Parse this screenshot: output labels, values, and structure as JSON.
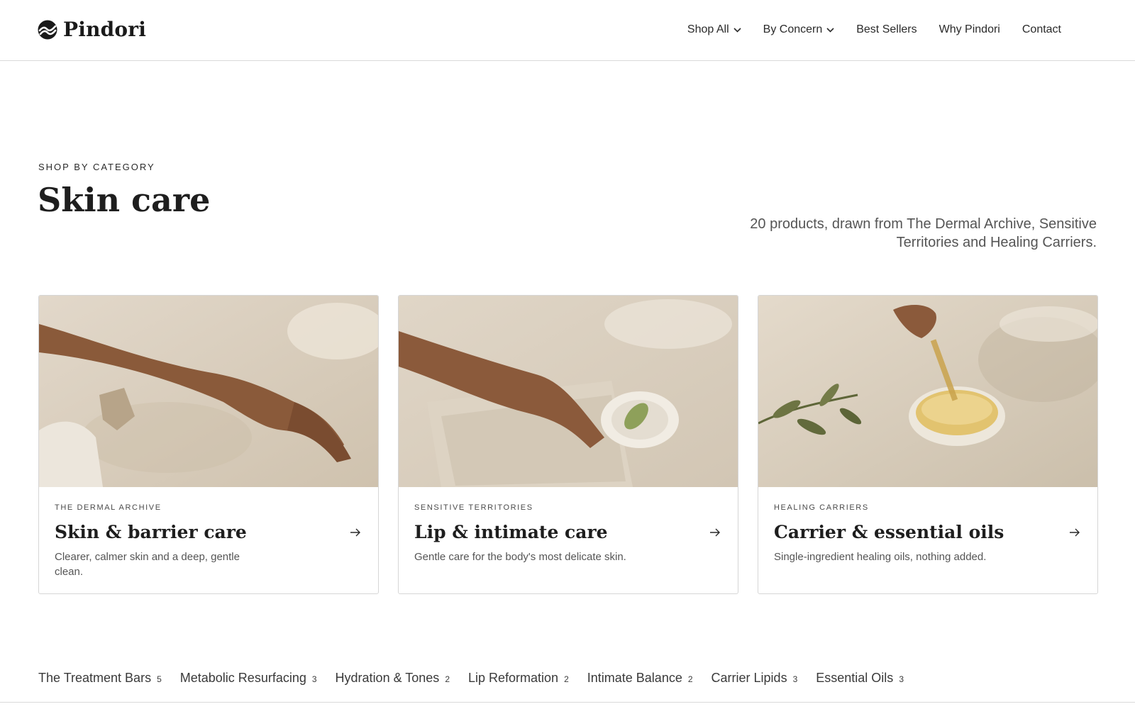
{
  "brand": {
    "name": "Pindori",
    "logo_icon": "pindori-logo-icon"
  },
  "nav": {
    "items": [
      {
        "label": "Shop All",
        "dropdown": true
      },
      {
        "label": "By Concern",
        "dropdown": true
      },
      {
        "label": "Best Sellers",
        "dropdown": false
      },
      {
        "label": "Why Pindori",
        "dropdown": false
      },
      {
        "label": "Contact",
        "dropdown": false
      }
    ]
  },
  "hero": {
    "eyebrow": "SHOP BY CATEGORY",
    "title": "Skin care",
    "intro": "20 products, drawn from The Dermal Archive, Sensitive Territories and Healing Carriers."
  },
  "cards": [
    {
      "eyebrow": "THE DERMAL ARCHIVE",
      "title": "Skin & barrier care",
      "description": "Clearer, calmer skin and a deep, gentle clean.",
      "image": "arm-in-water-on-stone-image",
      "icon": "arrow-right-icon"
    },
    {
      "eyebrow": "SENSITIVE TERRITORIES",
      "title": "Lip & intimate care",
      "description": "Gentle care for the body's most delicate skin.",
      "image": "hand-on-linen-with-aloe-dish-image",
      "icon": "arrow-right-icon"
    },
    {
      "eyebrow": "HEALING CARRIERS",
      "title": "Carrier & essential oils",
      "description": "Single-ingredient healing oils, nothing added.",
      "image": "hand-dropper-oil-bowl-image",
      "icon": "arrow-right-icon"
    }
  ],
  "subcategories": [
    {
      "label": "The Treatment Bars",
      "count": "5"
    },
    {
      "label": "Metabolic Resurfacing",
      "count": "3"
    },
    {
      "label": "Hydration & Tones",
      "count": "2"
    },
    {
      "label": "Lip Reformation",
      "count": "2"
    },
    {
      "label": "Intimate Balance",
      "count": "2"
    },
    {
      "label": "Carrier Lipids",
      "count": "3"
    },
    {
      "label": "Essential Oils",
      "count": "3"
    }
  ],
  "colors": {
    "text": "#1e1e1e",
    "muted": "#555555",
    "border": "#d6d6d6",
    "photo_sand": "#d8cdbd"
  }
}
